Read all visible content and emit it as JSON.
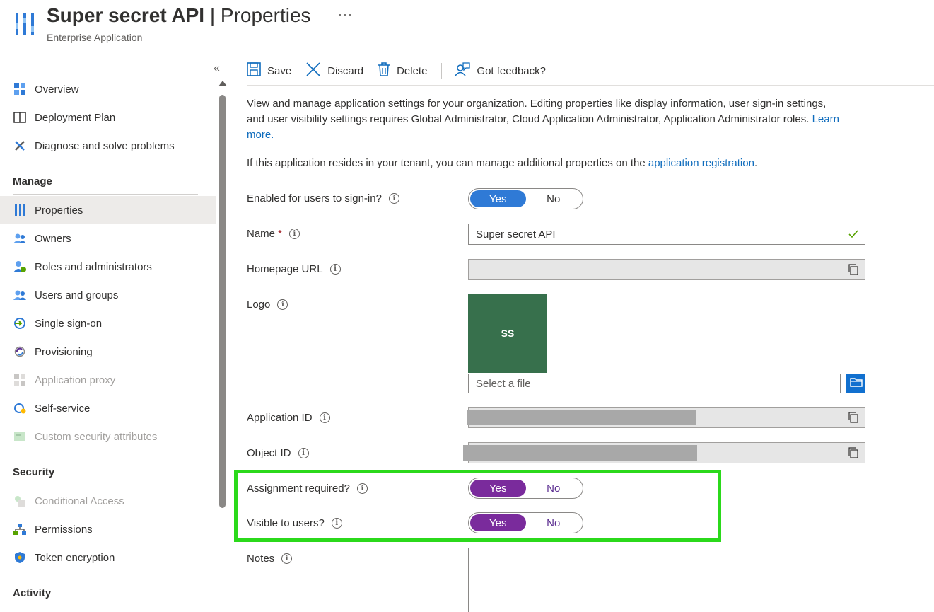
{
  "header": {
    "title": "Super secret API",
    "separator": "|",
    "subtitle_page": "Properties",
    "caption": "Enterprise Application",
    "more": "···"
  },
  "sidebar": {
    "collapse": "«",
    "top_items": [
      {
        "label": "Overview",
        "icon": "grid-icon"
      },
      {
        "label": "Deployment Plan",
        "icon": "book-icon"
      },
      {
        "label": "Diagnose and solve problems",
        "icon": "wrench-icon"
      }
    ],
    "sections": [
      {
        "title": "Manage"
      },
      {
        "title": "Security"
      },
      {
        "title": "Activity"
      }
    ],
    "manage_items": [
      {
        "label": "Properties",
        "icon": "properties-icon",
        "active": true
      },
      {
        "label": "Owners",
        "icon": "owners-icon"
      },
      {
        "label": "Roles and administrators",
        "icon": "roles-icon"
      },
      {
        "label": "Users and groups",
        "icon": "users-icon"
      },
      {
        "label": "Single sign-on",
        "icon": "sso-icon"
      },
      {
        "label": "Provisioning",
        "icon": "provisioning-icon"
      },
      {
        "label": "Application proxy",
        "icon": "app-proxy-icon",
        "disabled": true
      },
      {
        "label": "Self-service",
        "icon": "self-service-icon"
      },
      {
        "label": "Custom security attributes",
        "icon": "custom-attr-icon",
        "disabled": true
      }
    ],
    "security_items": [
      {
        "label": "Conditional Access",
        "icon": "conditional-access-icon",
        "disabled": true
      },
      {
        "label": "Permissions",
        "icon": "permissions-icon"
      },
      {
        "label": "Token encryption",
        "icon": "shield-icon"
      }
    ]
  },
  "toolbar": {
    "save": "Save",
    "discard": "Discard",
    "delete": "Delete",
    "feedback": "Got feedback?"
  },
  "content": {
    "description": "View and manage application settings for your organization. Editing properties like display information, user sign-in settings, and user visibility settings requires Global Administrator, Cloud Application Administrator, Application Administrator roles.",
    "learn_more": "Learn more.",
    "tenant_text": "If this application resides in your tenant, you can manage additional properties on the",
    "tenant_link": "application registration",
    "tenant_end": "."
  },
  "form": {
    "enabled_label": "Enabled for users to sign-in?",
    "enabled_yes": "Yes",
    "enabled_no": "No",
    "name_label": "Name",
    "name_required": "*",
    "name_value": "Super secret API",
    "homepage_label": "Homepage URL",
    "logo_label": "Logo",
    "logo_initials": "SS",
    "file_placeholder": "Select a file",
    "app_id_label": "Application ID",
    "object_id_label": "Object ID",
    "assignment_label": "Assignment required?",
    "assignment_yes": "Yes",
    "assignment_no": "No",
    "visible_label": "Visible to users?",
    "visible_yes": "Yes",
    "visible_no": "No",
    "notes_label": "Notes"
  },
  "colors": {
    "accent": "#2f7ad6",
    "purple_toggle": "#7a2b9c",
    "highlight": "#2bd91b",
    "logo_bg": "#37704c"
  }
}
